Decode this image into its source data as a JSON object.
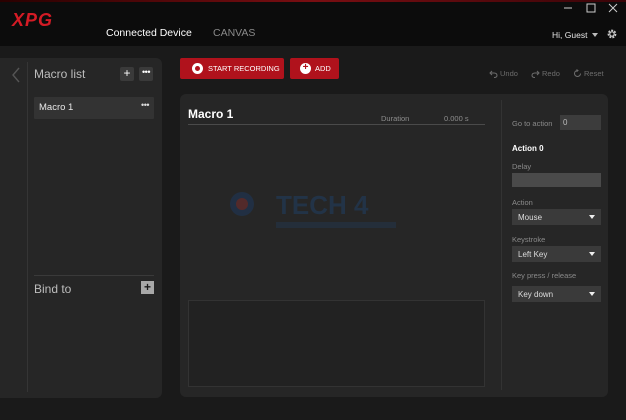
{
  "window": {
    "nav_tabs": [
      {
        "label": "Connected Device"
      },
      {
        "label": "CANVAS"
      }
    ],
    "user_greeting": "Hi, Guest",
    "accent_color": "#b0121c",
    "brand_logo_text": "XPG"
  },
  "left_panel": {
    "title": "Macro list",
    "macros": [
      {
        "name": "Macro 1"
      }
    ],
    "bind_to_label": "Bind to"
  },
  "toolbar": {
    "start_recording_label": "START RECORDING",
    "add_label": "ADD",
    "undo_label": "Undo",
    "redo_label": "Redo",
    "reset_label": "Reset"
  },
  "editor": {
    "macro_title": "Macro 1",
    "duration_label": "Duration",
    "duration_value": "0.000 s",
    "watermark_text": "TECH 4"
  },
  "action_panel": {
    "goto_label": "Go to action",
    "goto_value": "0",
    "action_heading": "Action 0",
    "delay_label": "Delay",
    "delay_value": "",
    "action_label": "Action",
    "action_value": "Mouse",
    "keystroke_label": "Keystroke",
    "keystroke_value": "Left Key",
    "press_label": "Key press / release",
    "press_value": "Key down"
  }
}
